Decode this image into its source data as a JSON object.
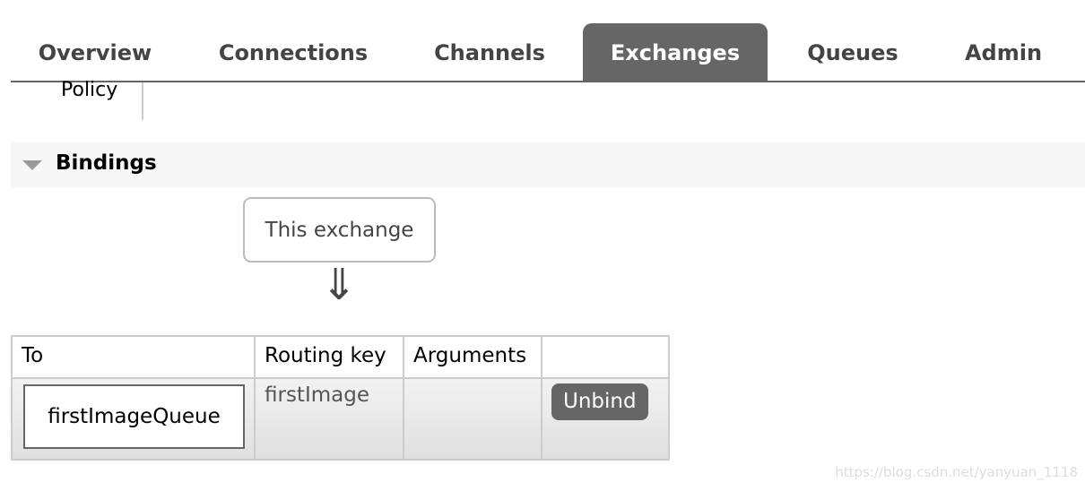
{
  "nav": {
    "tabs": [
      {
        "label": "Overview"
      },
      {
        "label": "Connections"
      },
      {
        "label": "Channels"
      },
      {
        "label": "Exchanges",
        "active": true
      },
      {
        "label": "Queues"
      },
      {
        "label": "Admin"
      }
    ]
  },
  "policy_label": "Policy",
  "bindings": {
    "title": "Bindings",
    "source_label": "This exchange",
    "arrow": "⇓",
    "columns": [
      "To",
      "Routing key",
      "Arguments",
      ""
    ],
    "rows": [
      {
        "to": "firstImageQueue",
        "routing_key": "firstImage",
        "arguments": "",
        "action": "Unbind"
      }
    ]
  },
  "watermark": "https://blog.csdn.net/yanyuan_1118",
  "colors": {
    "active_tab": "#666666",
    "button": "#666666"
  }
}
